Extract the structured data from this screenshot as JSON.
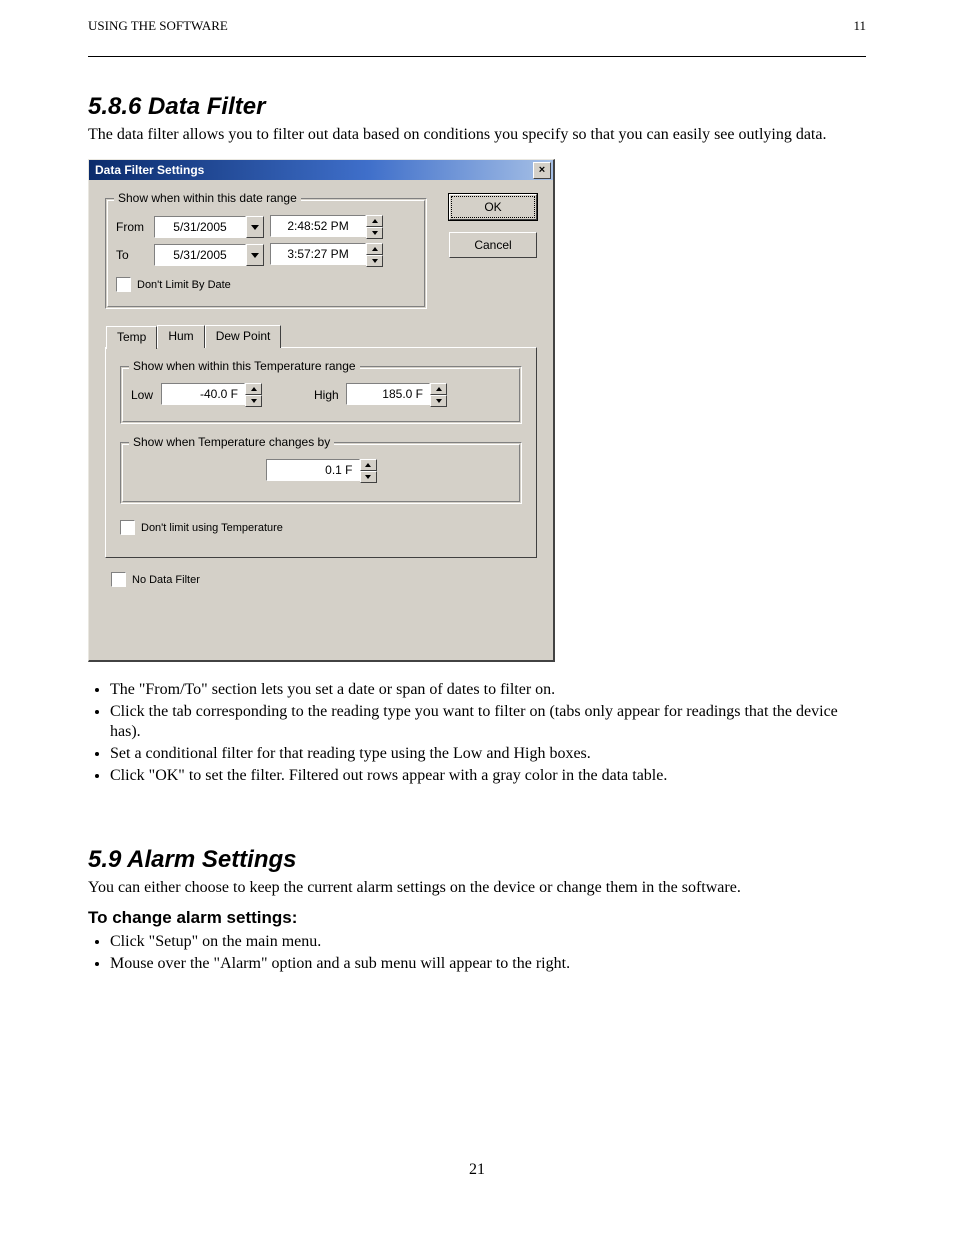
{
  "doc": {
    "header_left": "USING THE SOFTWARE",
    "header_right": "11",
    "h1": "5.8.6 Data Filter",
    "p1": "The data filter allows you to filter out data based on conditions you specify so that you can easily see outlying data.",
    "bullets1": [
      "The \"From/To\" section lets you set a date or span of dates to filter on.",
      "Click the tab corresponding to the reading type you want to filter on (tabs only appear for readings that the device has).",
      "Set a conditional filter for that reading type using the Low and High boxes.",
      "Click \"OK\" to set the filter. Filtered out rows appear with a gray color in the data table."
    ],
    "h2": "5.9 Alarm Settings",
    "p2": "You can either choose to keep the current alarm settings on the device or change them in the software.",
    "sub": "To change alarm settings:",
    "steps_a": [
      "Click \"Setup\" on the main menu.",
      "Mouse over the \"Alarm\" option and a sub menu will appear to the right."
    ],
    "footer_page": "21"
  },
  "dlg": {
    "title": "Data Filter Settings",
    "close": "×",
    "ok": "OK",
    "cancel": "Cancel",
    "grp_date_caption": "Show when within this date range",
    "from_label": "From",
    "to_label": "To",
    "from_date": "5/31/2005",
    "to_date": "5/31/2005",
    "from_time": "2:48:52 PM",
    "to_time": "3:57:27 PM",
    "dont_limit_date": "Don't Limit By Date",
    "tabs": {
      "temp": "Temp",
      "hum": "Hum",
      "dew": "Dew Point"
    },
    "grp_temp_caption": "Show when within this Temperature range",
    "low_label": "Low",
    "high_label": "High",
    "low_value": "-40.0 F",
    "high_value": "185.0 F",
    "grp_delta_caption": "Show when Temperature changes by",
    "delta_value": "0.1 F",
    "dont_limit_temp": "Don't limit using Temperature",
    "no_filter": "No Data Filter"
  }
}
